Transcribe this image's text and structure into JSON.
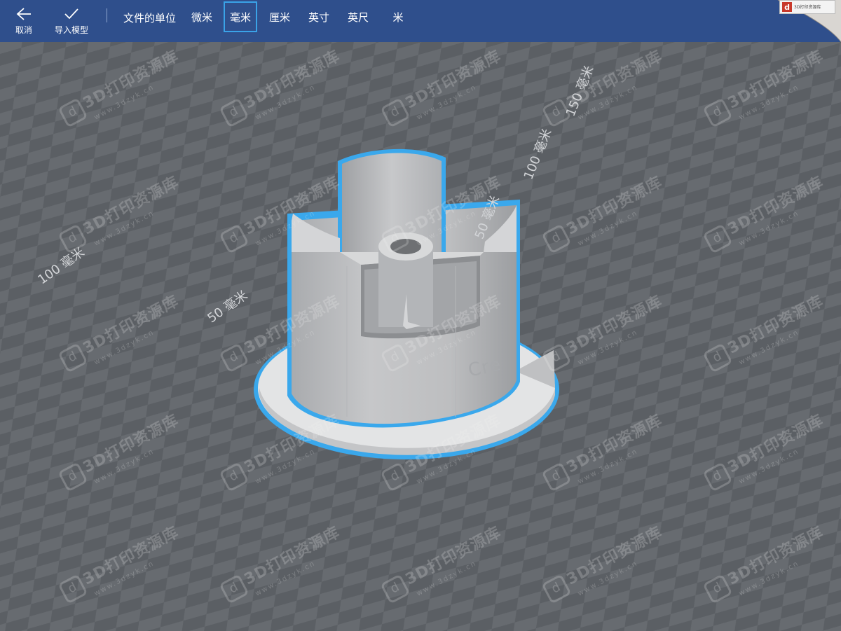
{
  "toolbar": {
    "cancel": {
      "label": "取消",
      "icon": "back-arrow-icon"
    },
    "import": {
      "label": "导入模型",
      "icon": "checkmark-icon"
    },
    "unit_caption": "文件的单位",
    "units": [
      {
        "label": "微米",
        "selected": false
      },
      {
        "label": "毫米",
        "selected": true
      },
      {
        "label": "厘米",
        "selected": false
      },
      {
        "label": "英寸",
        "selected": false
      },
      {
        "label": "英尺",
        "selected": false
      },
      {
        "label": "米",
        "selected": false
      }
    ],
    "colors": {
      "bar": "#2f4f8c",
      "selection": "#3aa3e8"
    }
  },
  "site_logo": {
    "mark": "d",
    "text": "3D打印资源库"
  },
  "viewport": {
    "floor_colors": [
      "#5b5f64",
      "#676b70"
    ],
    "ruler_labels": {
      "left_100": "100 毫米",
      "left_50": "50 毫米",
      "right_50": "50 毫米",
      "right_100": "100 毫米",
      "right_150": "150 毫米"
    },
    "model": {
      "name_fragment": "Cre",
      "fill": "#c9cacc",
      "outline": "#3aa8ec"
    },
    "watermark": {
      "logo": "d",
      "text": "3D打印资源库",
      "url": "www.3dzyk.cn"
    }
  }
}
